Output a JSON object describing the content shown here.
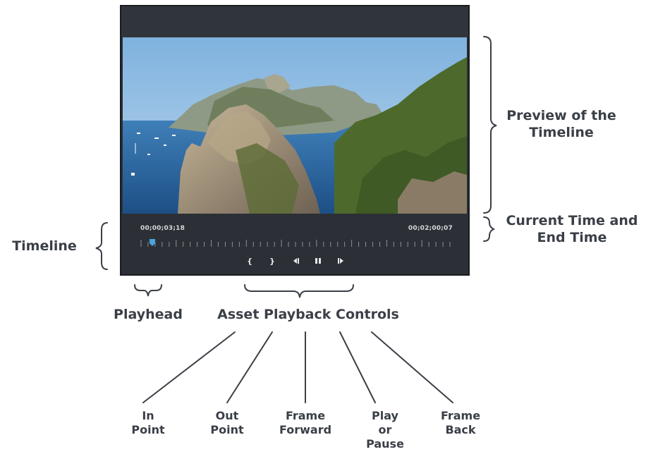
{
  "player": {
    "current_time": "00;00;03;18",
    "end_time": "00;02;00;07",
    "timeline_position": 0.03,
    "controls": {
      "in_point": "{",
      "out_point": "}"
    }
  },
  "labels": {
    "preview": "Preview of the\nTimeline",
    "time": "Current Time and\nEnd Time",
    "timeline": "Timeline",
    "playhead": "Playhead",
    "asset_controls": "Asset Playback Controls",
    "in_point": "In\nPoint",
    "out_point": "Out\nPoint",
    "frame_forward": "Frame\nForward",
    "play_pause": "Play\nor\nPause",
    "frame_back": "Frame\nBack"
  },
  "colors": {
    "label_text": "#3a3f47",
    "player_bg": "#2b2f35",
    "playhead": "#4aa3df"
  }
}
